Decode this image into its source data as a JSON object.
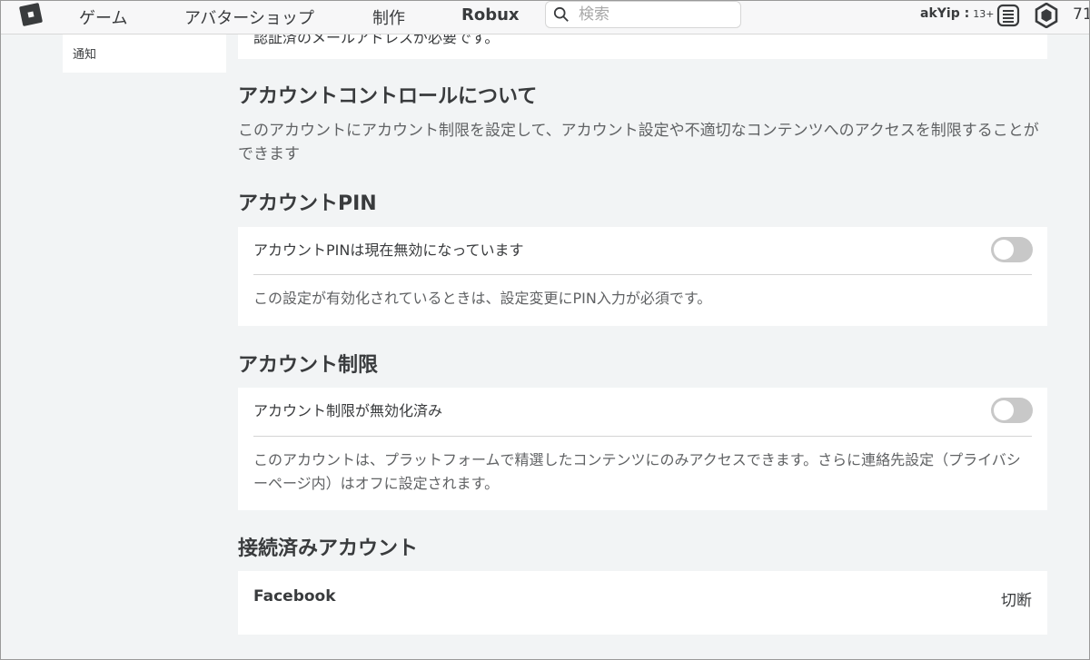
{
  "nav": {
    "games": "ゲーム",
    "avatar_shop": "アバターショップ",
    "create": "制作",
    "robux": "Robux",
    "search_placeholder": "検索",
    "username": "akYip :",
    "age_badge": "13+",
    "robux_count": "71"
  },
  "sidebar": {
    "items": [
      {
        "label": "通知"
      }
    ]
  },
  "top_card": {
    "cut_text": "認証済のメールアドレスが必要です。"
  },
  "account_controls": {
    "title": "アカウントコントロールについて",
    "description": "このアカウントにアカウント制限を設定して、アカウント設定や不適切なコンテンツへのアクセスを制限することができます"
  },
  "account_pin": {
    "title": "アカウントPIN",
    "status": "アカウントPINは現在無効になっています",
    "enabled": false,
    "description": "この設定が有効化されているときは、設定変更にPIN入力が必須です。"
  },
  "account_restrictions": {
    "title": "アカウント制限",
    "status": "アカウント制限が無効化済み",
    "enabled": false,
    "description": "このアカウントは、プラットフォームで精選したコンテンツにのみアクセスできます。さらに連絡先設定（プライバシーページ内）はオフに設定されます。"
  },
  "connected_accounts": {
    "title": "接続済みアカウント",
    "items": [
      {
        "provider": "Facebook",
        "action": "切断"
      }
    ]
  },
  "colors": {
    "background": "#f2f4f5",
    "card": "#ffffff",
    "text": "#393b3d",
    "muted_text": "#606264",
    "toggle_off": "#c8c8c8"
  }
}
